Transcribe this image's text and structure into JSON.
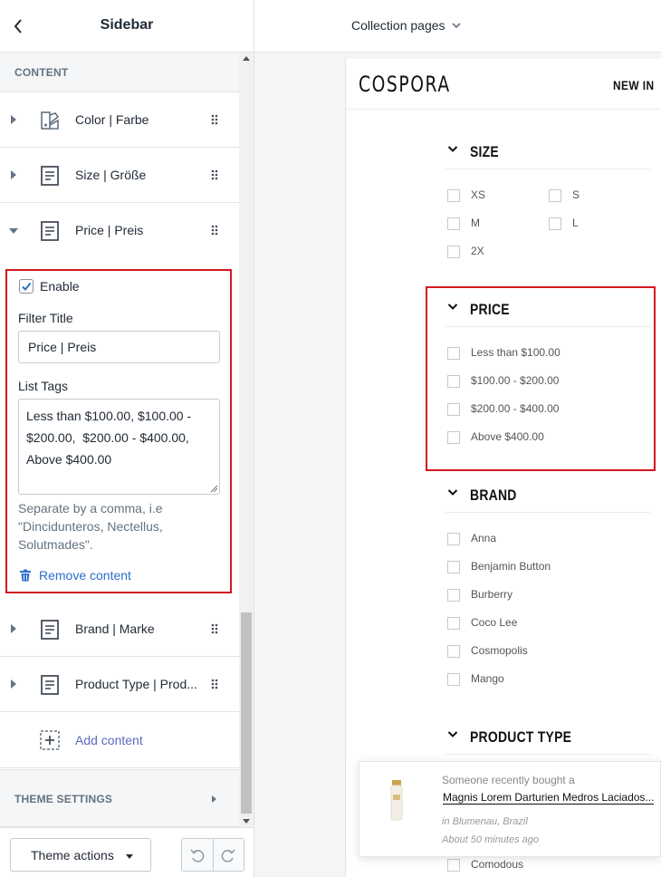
{
  "sidebar": {
    "title": "Sidebar",
    "content_section": "CONTENT",
    "blocks": [
      {
        "label": "Color | Farbe",
        "icon": "color-swatch-icon"
      },
      {
        "label": "Size | Größe",
        "icon": "text-block-icon"
      },
      {
        "label": "Price | Preis",
        "icon": "text-block-icon"
      },
      {
        "label": "Brand | Marke",
        "icon": "text-block-icon"
      },
      {
        "label": "Product Type | Prod...",
        "icon": "text-block-icon"
      }
    ],
    "editor": {
      "enable_label": "Enable",
      "enabled": true,
      "filter_title_label": "Filter Title",
      "filter_title_value": "Price | Preis",
      "list_tags_label": "List Tags",
      "list_tags_value": "Less than $100.00, $100.00 - $200.00,  $200.00 - $400.00, Above $400.00",
      "help_text": "Separate by a comma, i.e \"Dincidunteros, Nectellus, Solutmades\".",
      "remove_label": "Remove content"
    },
    "add_content_label": "Add content",
    "theme_settings_label": "THEME SETTINGS",
    "footer": {
      "theme_actions_label": "Theme actions"
    }
  },
  "topbar": {
    "page_selector": "Collection pages"
  },
  "preview": {
    "logo": "COSPORA",
    "nav_item": "NEW IN",
    "filters": [
      {
        "title": "SIZE",
        "options": [
          "XS",
          "S",
          "M",
          "L",
          "2X"
        ]
      },
      {
        "title": "PRICE",
        "options": [
          "Less than $100.00",
          "$100.00 - $200.00",
          "$200.00 - $400.00",
          "Above $400.00"
        ]
      },
      {
        "title": "BRAND",
        "options": [
          "Anna",
          "Benjamin Button",
          "Burberry",
          "Coco Lee",
          "Cosmopolis",
          "Mango"
        ]
      },
      {
        "title": "PRODUCT TYPE",
        "options": [
          "Comodous"
        ]
      }
    ],
    "toast": {
      "line1": "Someone recently bought a",
      "product": "Magnis Lorem Darturien Medros Laciados...",
      "location": "in Blumenau, Brazil",
      "time": "About 50 minutes ago"
    }
  },
  "colors": {
    "highlight": "#d3171f",
    "link": "#2c6ecb",
    "add_link": "#5c6ac4"
  }
}
